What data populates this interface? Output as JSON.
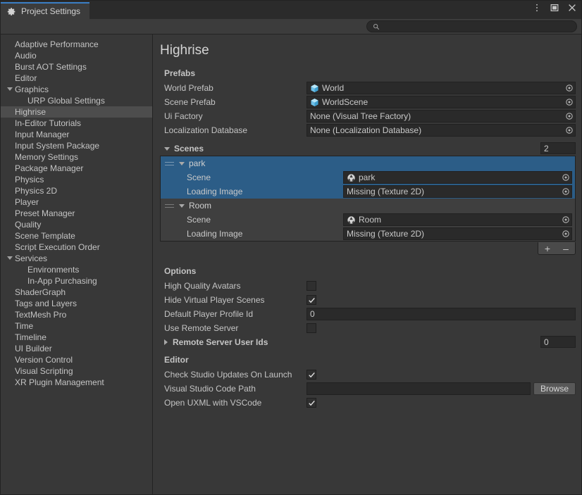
{
  "window": {
    "tab_label": "Project Settings",
    "tab_icon": "gear-icon",
    "controls": {
      "menu": "kebab-menu-icon",
      "maximize": "maximize-icon",
      "close": "close-icon"
    }
  },
  "search": {
    "value": "",
    "placeholder": "",
    "icon": "search-icon"
  },
  "sidebar": {
    "items": [
      {
        "label": "Adaptive Performance",
        "level": 0,
        "selected": false,
        "expandable": false
      },
      {
        "label": "Audio",
        "level": 0,
        "selected": false,
        "expandable": false
      },
      {
        "label": "Burst AOT Settings",
        "level": 0,
        "selected": false,
        "expandable": false
      },
      {
        "label": "Editor",
        "level": 0,
        "selected": false,
        "expandable": false
      },
      {
        "label": "Graphics",
        "level": 0,
        "selected": false,
        "expandable": true
      },
      {
        "label": "URP Global Settings",
        "level": 1,
        "selected": false,
        "expandable": false
      },
      {
        "label": "Highrise",
        "level": 0,
        "selected": true,
        "expandable": false
      },
      {
        "label": "In-Editor Tutorials",
        "level": 0,
        "selected": false,
        "expandable": false
      },
      {
        "label": "Input Manager",
        "level": 0,
        "selected": false,
        "expandable": false
      },
      {
        "label": "Input System Package",
        "level": 0,
        "selected": false,
        "expandable": false
      },
      {
        "label": "Memory Settings",
        "level": 0,
        "selected": false,
        "expandable": false
      },
      {
        "label": "Package Manager",
        "level": 0,
        "selected": false,
        "expandable": false
      },
      {
        "label": "Physics",
        "level": 0,
        "selected": false,
        "expandable": false
      },
      {
        "label": "Physics 2D",
        "level": 0,
        "selected": false,
        "expandable": false
      },
      {
        "label": "Player",
        "level": 0,
        "selected": false,
        "expandable": false
      },
      {
        "label": "Preset Manager",
        "level": 0,
        "selected": false,
        "expandable": false
      },
      {
        "label": "Quality",
        "level": 0,
        "selected": false,
        "expandable": false
      },
      {
        "label": "Scene Template",
        "level": 0,
        "selected": false,
        "expandable": false
      },
      {
        "label": "Script Execution Order",
        "level": 0,
        "selected": false,
        "expandable": false
      },
      {
        "label": "Services",
        "level": 0,
        "selected": false,
        "expandable": true
      },
      {
        "label": "Environments",
        "level": 1,
        "selected": false,
        "expandable": false
      },
      {
        "label": "In-App Purchasing",
        "level": 1,
        "selected": false,
        "expandable": false
      },
      {
        "label": "ShaderGraph",
        "level": 0,
        "selected": false,
        "expandable": false
      },
      {
        "label": "Tags and Layers",
        "level": 0,
        "selected": false,
        "expandable": false
      },
      {
        "label": "TextMesh Pro",
        "level": 0,
        "selected": false,
        "expandable": false
      },
      {
        "label": "Time",
        "level": 0,
        "selected": false,
        "expandable": false
      },
      {
        "label": "Timeline",
        "level": 0,
        "selected": false,
        "expandable": false
      },
      {
        "label": "UI Builder",
        "level": 0,
        "selected": false,
        "expandable": false
      },
      {
        "label": "Version Control",
        "level": 0,
        "selected": false,
        "expandable": false
      },
      {
        "label": "Visual Scripting",
        "level": 0,
        "selected": false,
        "expandable": false
      },
      {
        "label": "XR Plugin Management",
        "level": 0,
        "selected": false,
        "expandable": false
      }
    ]
  },
  "main": {
    "page_title": "Highrise",
    "prefabs": {
      "heading": "Prefabs",
      "fields": [
        {
          "label": "World Prefab",
          "value": "World",
          "icon": "prefab-icon"
        },
        {
          "label": "Scene Prefab",
          "value": "WorldScene",
          "icon": "prefab-icon"
        },
        {
          "label": "Ui Factory",
          "value": "None (Visual Tree Factory)",
          "icon": "none"
        },
        {
          "label": "Localization Database",
          "value": "None (Localization Database)",
          "icon": "none"
        }
      ]
    },
    "scenes": {
      "heading": "Scenes",
      "expanded": true,
      "count": "2",
      "entries": [
        {
          "name": "park",
          "expanded": true,
          "selected": true,
          "fields": [
            {
              "label": "Scene",
              "value": "park",
              "icon": "scene-icon"
            },
            {
              "label": "Loading Image",
              "value": "Missing (Texture 2D)",
              "icon": "none"
            }
          ]
        },
        {
          "name": "Room",
          "expanded": true,
          "selected": false,
          "fields": [
            {
              "label": "Scene",
              "value": "Room",
              "icon": "scene-icon"
            },
            {
              "label": "Loading Image",
              "value": "Missing (Texture 2D)",
              "icon": "none"
            }
          ]
        }
      ],
      "add_label": "+",
      "remove_label": "–"
    },
    "options": {
      "heading": "Options",
      "high_quality_avatars": {
        "label": "High Quality Avatars",
        "checked": false
      },
      "hide_virtual_player_scenes": {
        "label": "Hide Virtual Player Scenes",
        "checked": true
      },
      "default_player_profile_id": {
        "label": "Default Player Profile Id",
        "value": "0"
      },
      "use_remote_server": {
        "label": "Use Remote Server",
        "checked": false
      },
      "remote_server_user_ids": {
        "label": "Remote Server User Ids",
        "expanded": false,
        "count": "0"
      }
    },
    "editor": {
      "heading": "Editor",
      "check_studio_updates": {
        "label": "Check Studio Updates On Launch",
        "checked": true
      },
      "vscode_path": {
        "label": "Visual Studio Code Path",
        "value": "",
        "browse_label": "Browse"
      },
      "open_uxml_vscode": {
        "label": "Open UXML with VSCode",
        "checked": true
      }
    }
  },
  "colors": {
    "background": "#383838",
    "panel": "#3c3c3c",
    "field": "#2a2a2a",
    "selection_blue": "#2c5d87",
    "tab_accent": "#3b7fc4",
    "sidebar_selected": "#4d4d4d"
  }
}
